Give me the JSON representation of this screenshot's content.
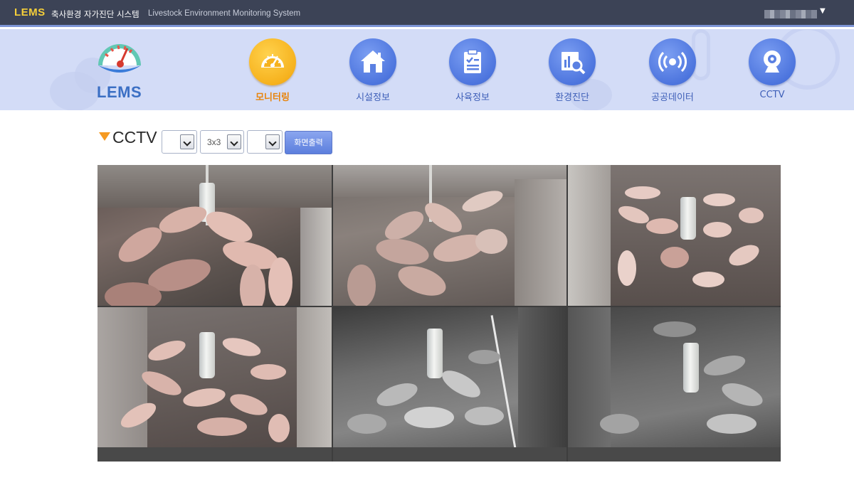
{
  "header": {
    "brand": "LEMS",
    "title_ko": "축사환경 자가진단 시스템",
    "title_en": "Livestock Environment Monitoring System"
  },
  "logo": {
    "text": "LEMS"
  },
  "nav": [
    {
      "label": "모니터링",
      "icon": "gauge-icon",
      "active": true
    },
    {
      "label": "시설정보",
      "icon": "house-icon",
      "active": false
    },
    {
      "label": "사육정보",
      "icon": "clipboard-check-icon",
      "active": false
    },
    {
      "label": "환경진단",
      "icon": "chart-search-icon",
      "active": false
    },
    {
      "label": "공공데이터",
      "icon": "broadcast-icon",
      "active": false
    },
    {
      "label": "CCTV",
      "icon": "webcam-icon",
      "active": false
    }
  ],
  "cctv": {
    "title": "CCTV",
    "select1_value": "",
    "layout_value": "3x3",
    "select3_value": "",
    "print_button": "화면출력"
  },
  "colors": {
    "topbar": "#3c4356",
    "brand": "#f5cf3a",
    "nav_band": "#d3dcf7",
    "nav_active": "#f6b21e",
    "nav_icon": "#4d75de",
    "nav_label": "#3e5fb8",
    "nav_label_active": "#e8840b"
  }
}
